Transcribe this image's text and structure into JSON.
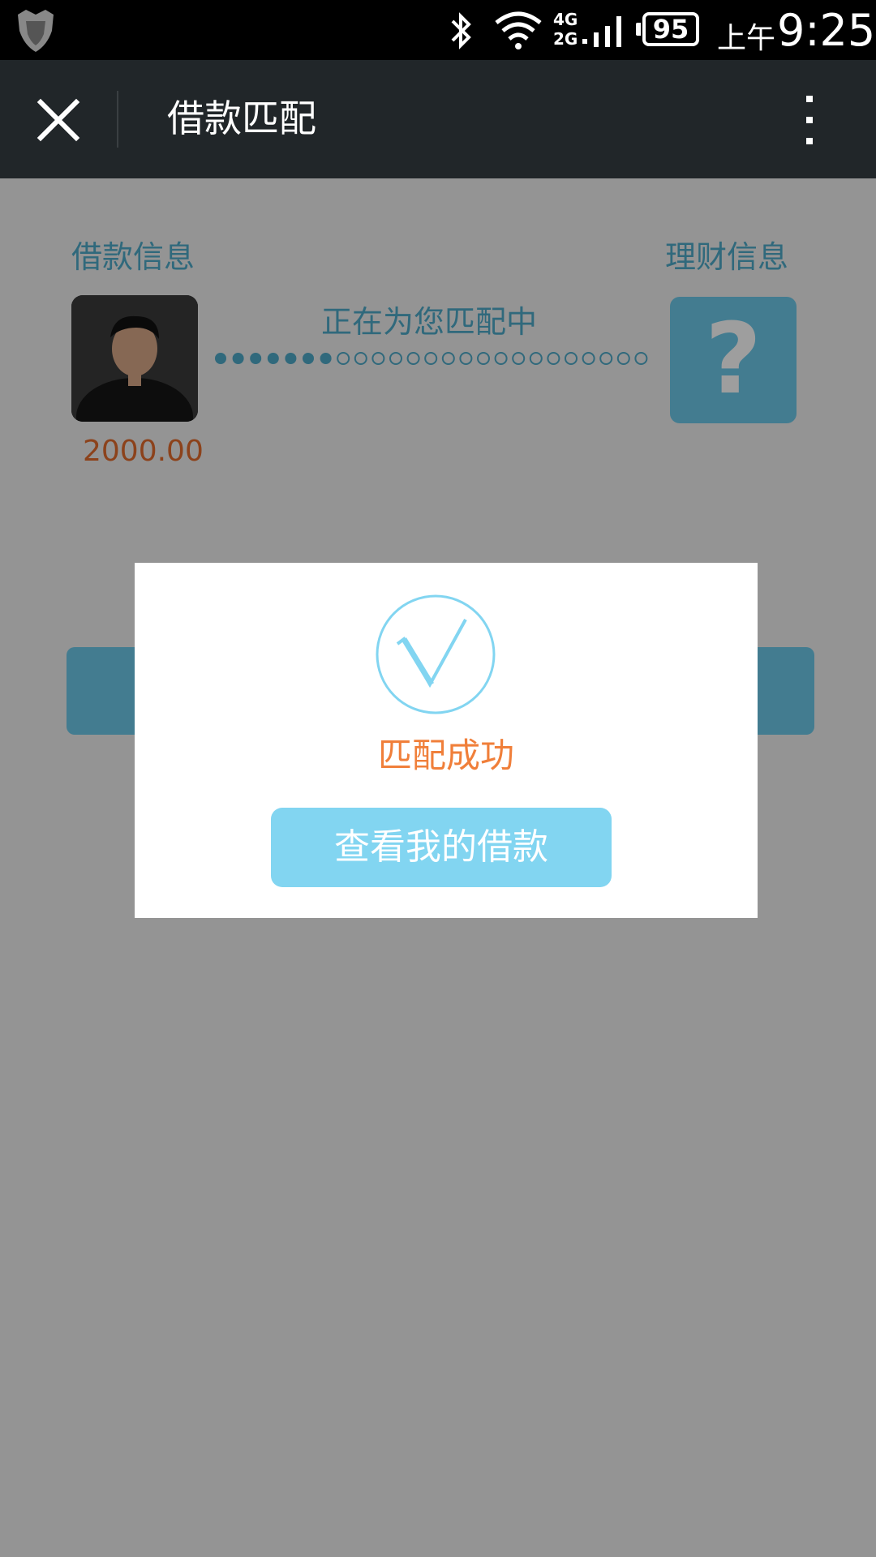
{
  "status_bar": {
    "network_label_top": "4G",
    "network_label_bottom": "2G",
    "battery": "95",
    "time_prefix": "上午",
    "time": "9:25",
    "icons": [
      "shield-icon",
      "bluetooth-icon",
      "wifi-icon",
      "signal-icon",
      "battery-icon"
    ]
  },
  "app_bar": {
    "title": "借款匹配",
    "icons": [
      "close-icon",
      "more-icon"
    ]
  },
  "main": {
    "loan_info_label": "借款信息",
    "finance_info_label": "理财信息",
    "amount": "2000.00",
    "matching_text": "正在为您匹配中",
    "unknown_symbol": "?",
    "progress": {
      "filled": 7,
      "total": 25
    }
  },
  "dialog": {
    "success_text": "匹配成功",
    "button_label": "查看我的借款",
    "icon": "checkmark-icon"
  },
  "colors": {
    "accent": "#4eaac8",
    "accent_light": "#82d5f1",
    "amount": "#e26b2d",
    "success": "#f07f3a",
    "appbar": "#212629"
  }
}
